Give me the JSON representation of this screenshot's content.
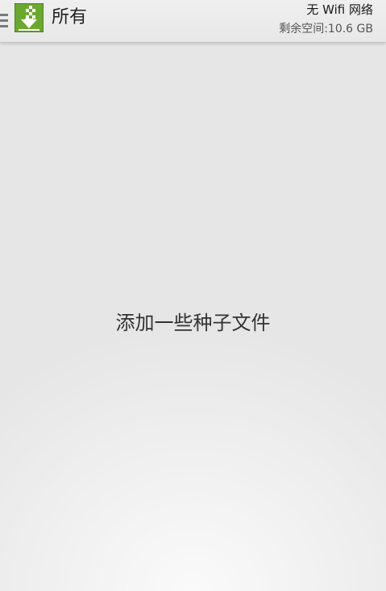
{
  "header": {
    "menu_icon": "hamburger-menu-icon",
    "app_icon": "torrent-download-logo-icon",
    "title": "所有",
    "network_status": "无 Wifi 网络",
    "free_space": "剩余空间:10.6 GB"
  },
  "main": {
    "empty_message": "添加一些种子文件"
  },
  "colors": {
    "logo_green": "#6aa82e",
    "logo_green_dark": "#3f7a1a",
    "background": "#ebebeb"
  }
}
